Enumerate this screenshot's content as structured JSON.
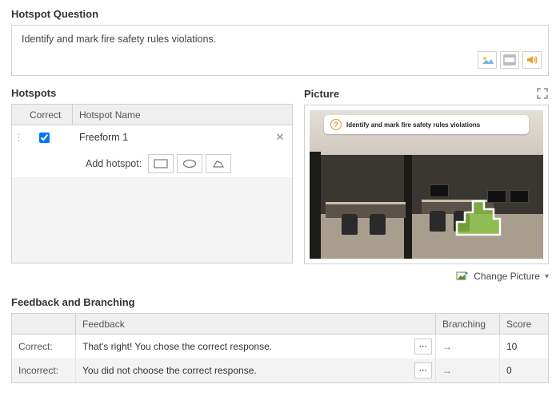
{
  "titles": {
    "hotspot_question": "Hotspot Question",
    "hotspots": "Hotspots",
    "picture": "Picture",
    "feedback": "Feedback and Branching"
  },
  "question": {
    "text": "Identify and mark fire safety rules violations."
  },
  "hotspots_table": {
    "header_correct": "Correct",
    "header_name": "Hotspot Name",
    "rows": [
      {
        "name": "Freeform 1",
        "correct": true
      }
    ],
    "add_label": "Add hotspot:"
  },
  "picture": {
    "banner_text": "Identify and mark fire safety rules violations",
    "change_label": "Change Picture"
  },
  "feedback_table": {
    "header_feedback": "Feedback",
    "header_branching": "Branching",
    "header_score": "Score",
    "rows": [
      {
        "label": "Correct:",
        "text": "That's right! You chose the correct response.",
        "score": "10"
      },
      {
        "label": "Incorrect:",
        "text": "You did not choose the correct response.",
        "score": "0"
      }
    ]
  }
}
